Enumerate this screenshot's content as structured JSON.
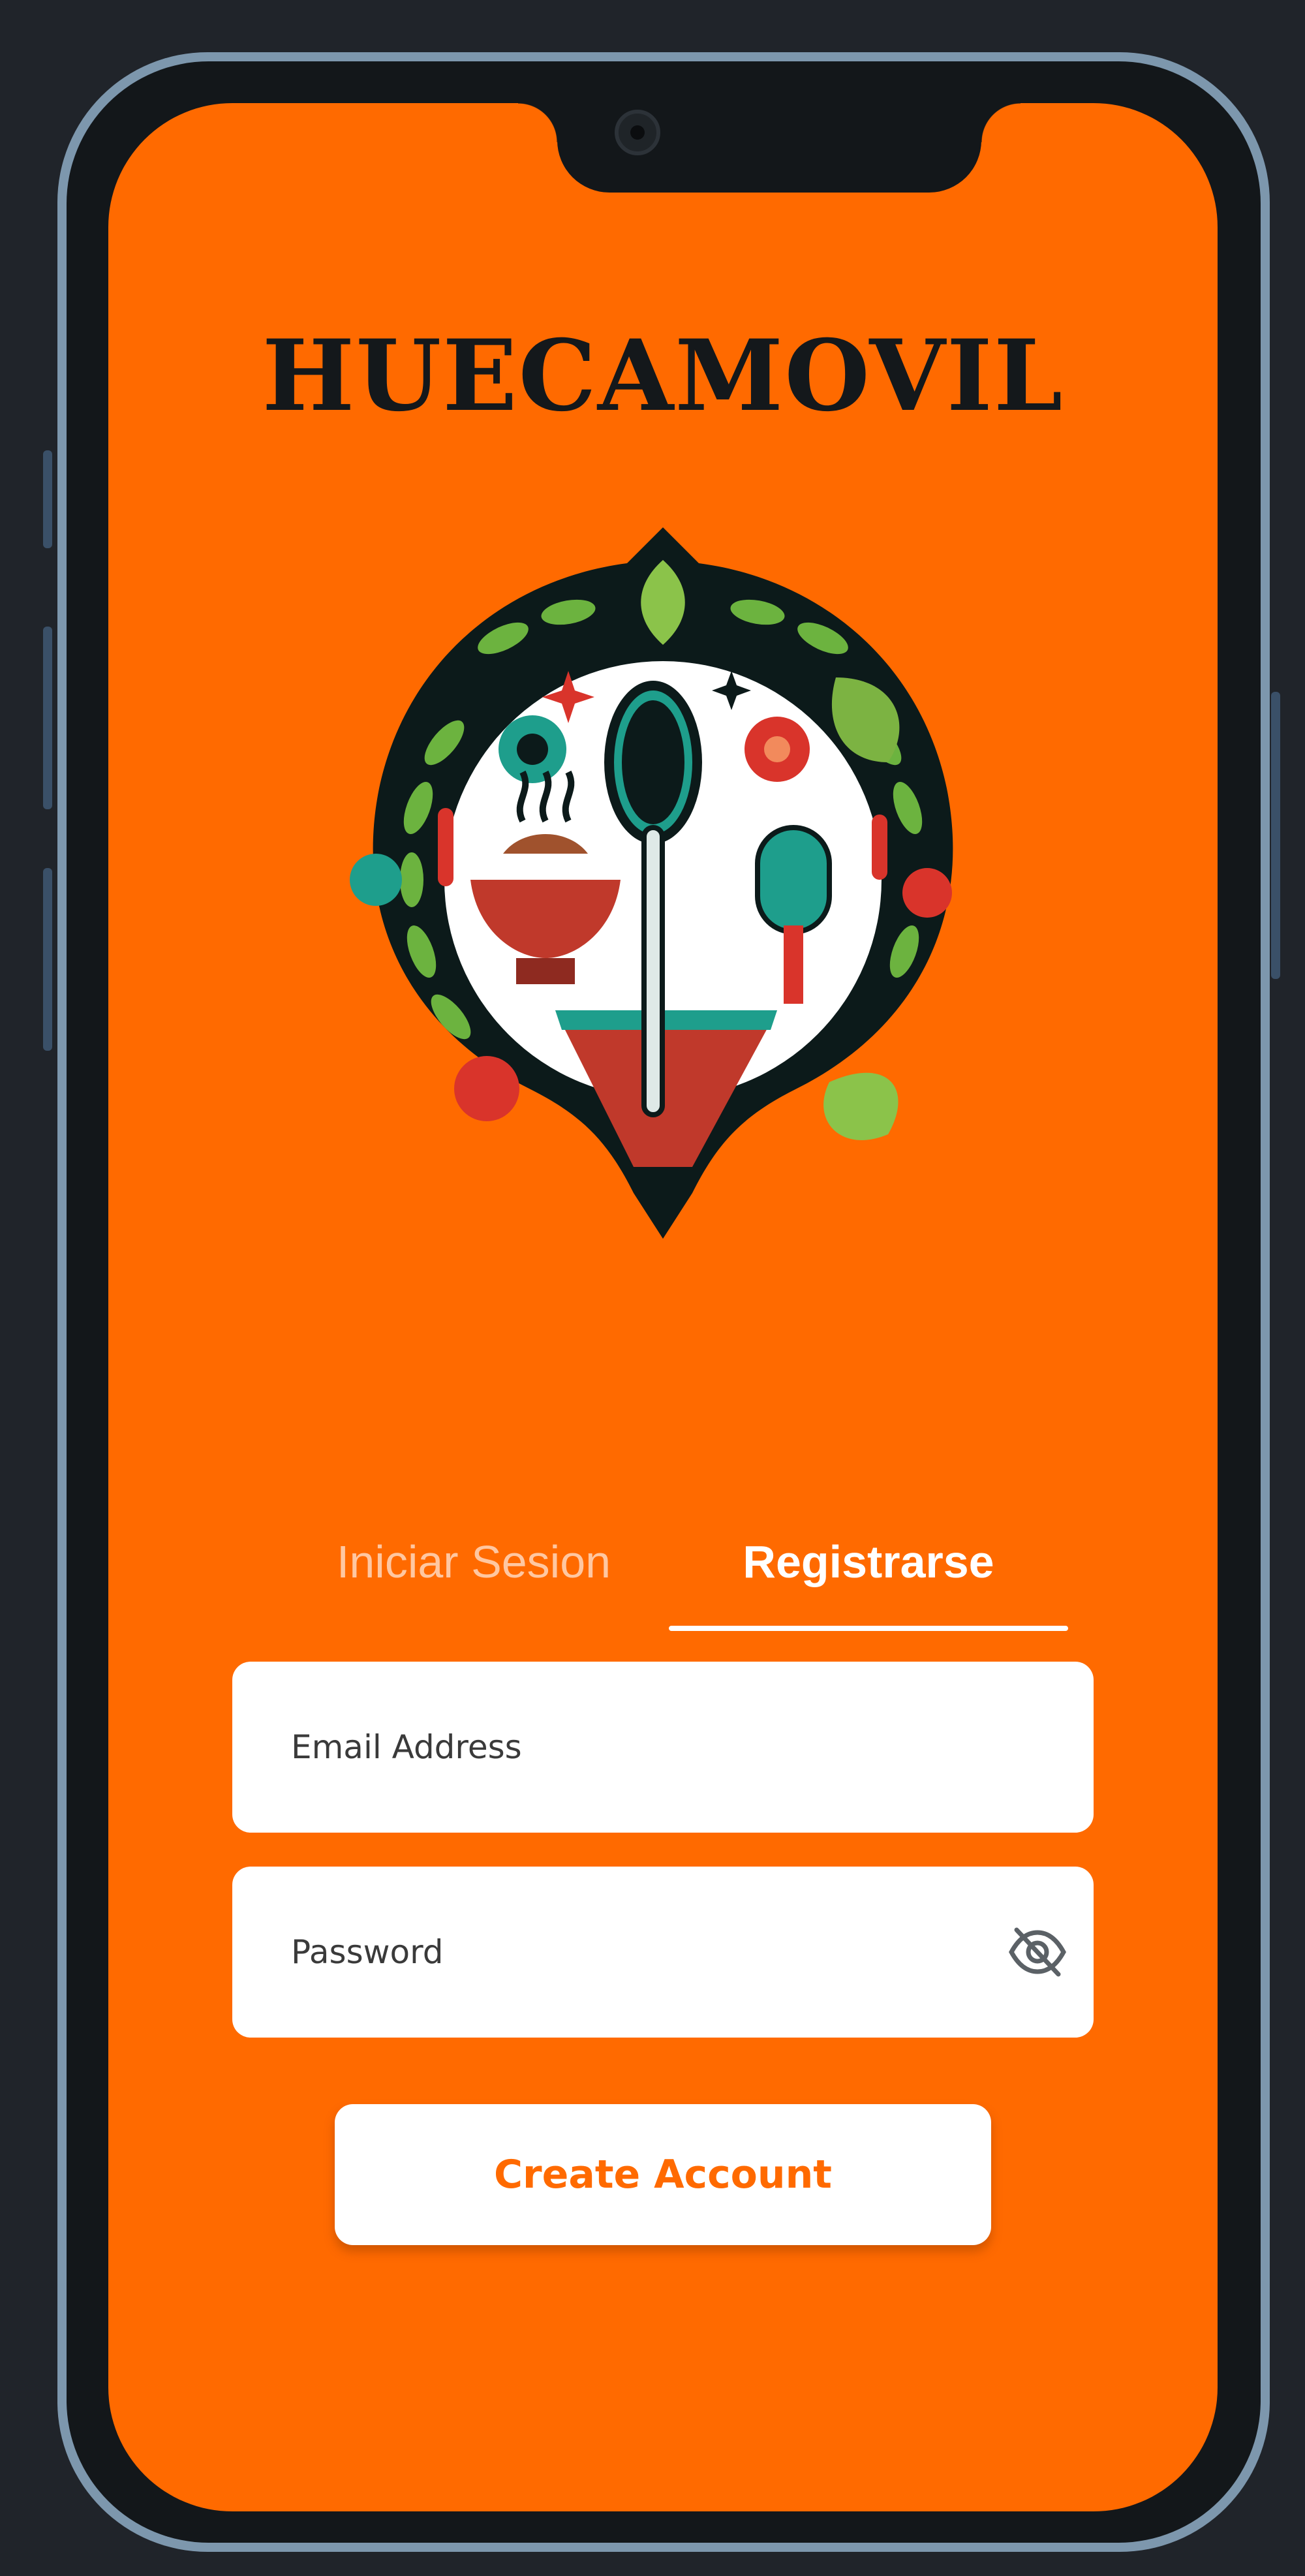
{
  "app": {
    "title": "HUECAMOVIL"
  },
  "tabs": [
    {
      "label": "Iniciar Sesion",
      "selected": false
    },
    {
      "label": "Registrarse",
      "selected": true
    }
  ],
  "form": {
    "email": {
      "placeholder": "Email Address",
      "value": ""
    },
    "password": {
      "placeholder": "Password",
      "value": "",
      "toggle_icon": "eye-off-icon"
    },
    "submit_label": "Create Account"
  },
  "colors": {
    "background": "#ff6a00",
    "surface": "#ffffff",
    "title_text": "#14181b",
    "inactive_tab_text": "#ffc7a1",
    "accent": "#ff6a00"
  }
}
